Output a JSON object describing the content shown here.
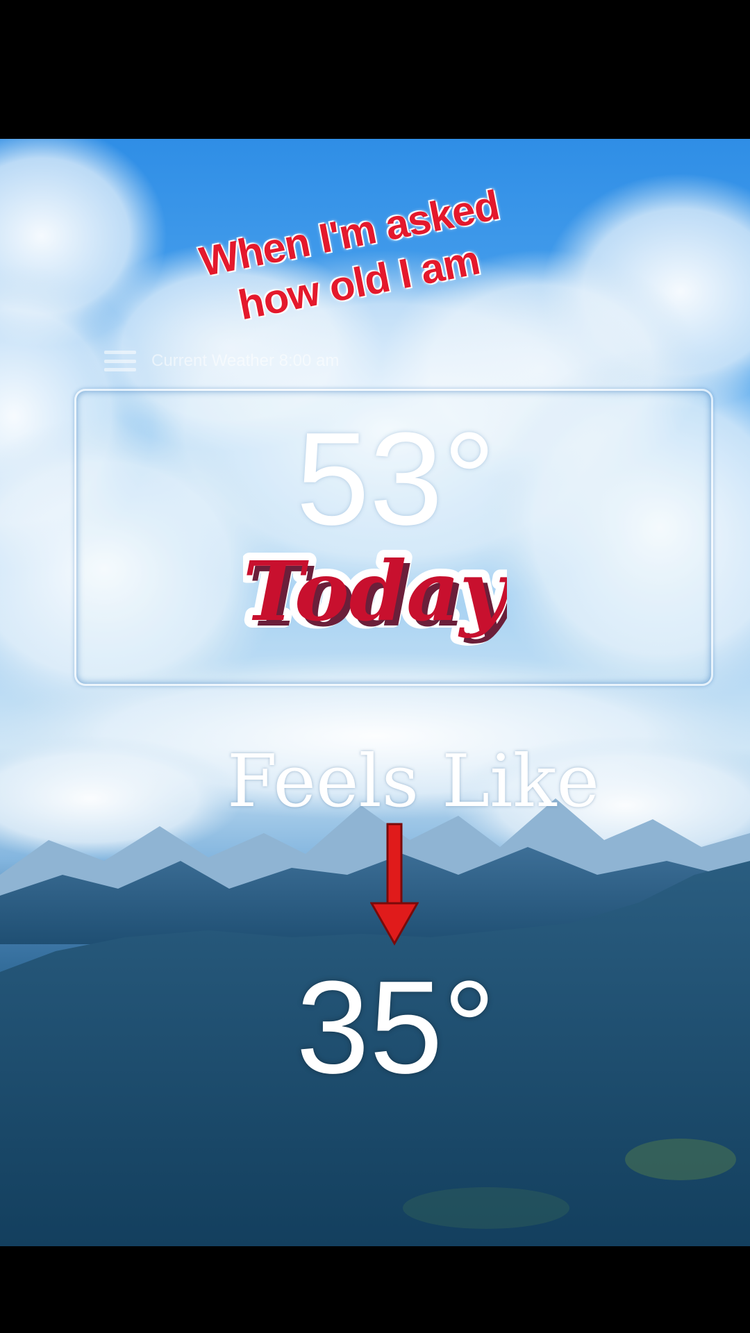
{
  "meme": {
    "caption": "When I'm asked how old I am",
    "sticker_text": "Today"
  },
  "app": {
    "title": "Current Weather 8:00 am"
  },
  "weather": {
    "temperature": "53°",
    "feels_like_label": "Feels Like",
    "feels_like_temperature": "35°"
  },
  "colors": {
    "caption_red": "#e4192c",
    "sticker_red": "#c8102e",
    "sticker_shadow": "#6b1f3a",
    "arrow_red": "#e01b1b"
  },
  "icons": [
    "menu-icon",
    "down-arrow-icon"
  ]
}
